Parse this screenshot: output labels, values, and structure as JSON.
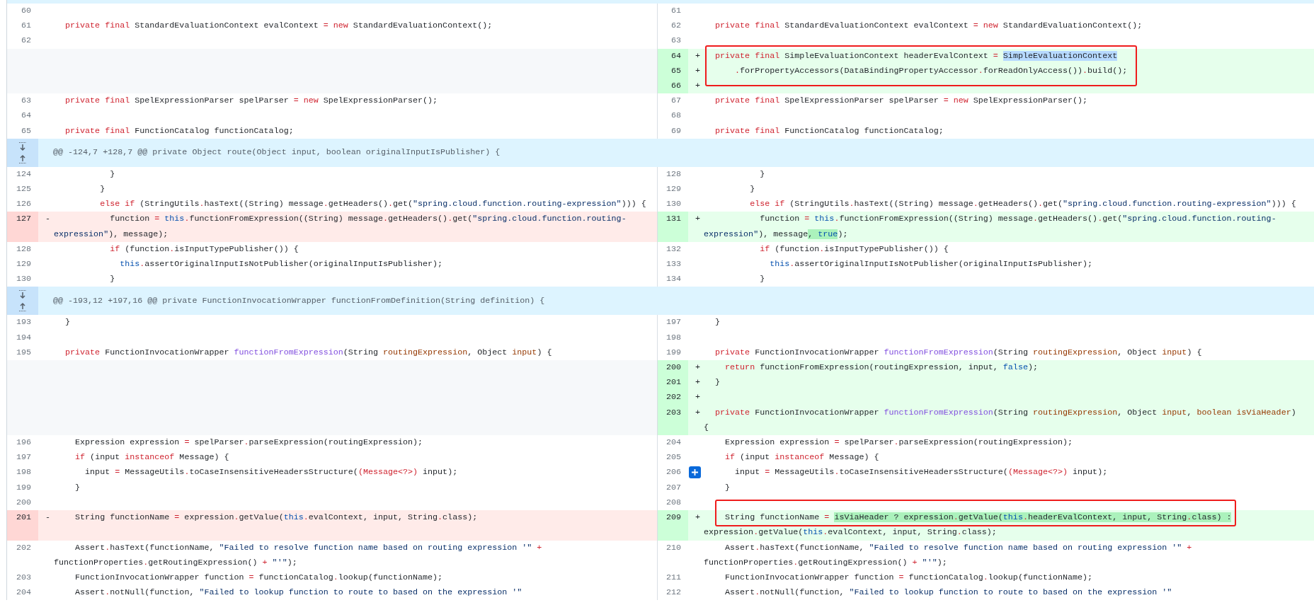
{
  "rows": [
    {
      "kind": "hunk-edge"
    },
    {
      "kind": "line",
      "left": {
        "number": "60",
        "kind": "context"
      },
      "right": {
        "number": "61",
        "kind": "context"
      }
    },
    {
      "kind": "line",
      "left": {
        "number": "61",
        "kind": "context",
        "code": [
          {
            "kind": "keyword",
            "text": "   private"
          },
          {
            "kind": "keyword",
            "text": " final"
          },
          {
            "kind": "plain",
            "text": " StandardEvaluationContext evalContext "
          },
          {
            "kind": "operator",
            "text": "="
          },
          {
            "kind": "keyword",
            "text": " new"
          },
          {
            "kind": "plain",
            "text": " StandardEvaluationContext();"
          }
        ]
      },
      "right": {
        "number": "62",
        "kind": "context",
        "code": [
          {
            "kind": "keyword",
            "text": "   private"
          },
          {
            "kind": "keyword",
            "text": " final"
          },
          {
            "kind": "plain",
            "text": " StandardEvaluationContext evalContext "
          },
          {
            "kind": "operator",
            "text": "="
          },
          {
            "kind": "keyword",
            "text": " new"
          },
          {
            "kind": "plain",
            "text": " StandardEvaluationContext();"
          }
        ]
      }
    },
    {
      "kind": "line",
      "left": {
        "number": "62",
        "kind": "context"
      },
      "right": {
        "number": "63",
        "kind": "context"
      }
    },
    {
      "kind": "line",
      "left": {
        "kind": "empty"
      },
      "right": {
        "number": "64",
        "kind": "added",
        "marker": "+",
        "framed": true,
        "code": [
          {
            "kind": "keyword",
            "text": "   private"
          },
          {
            "kind": "keyword",
            "text": " final"
          },
          {
            "kind": "plain",
            "text": " SimpleEvaluationContext headerEvalContext "
          },
          {
            "kind": "operator",
            "text": "= "
          },
          {
            "kind": "plain",
            "text": "SimpleEvaluationContext",
            "selected": true
          }
        ]
      }
    },
    {
      "kind": "line",
      "left": {
        "kind": "empty"
      },
      "right": {
        "number": "65",
        "kind": "added",
        "marker": "+",
        "framed": true,
        "code": [
          {
            "kind": "operator",
            "text": "       ."
          },
          {
            "kind": "plain",
            "text": "forPropertyAccessors(DataBindingPropertyAccessor"
          },
          {
            "kind": "operator",
            "text": "."
          },
          {
            "kind": "plain",
            "text": "forReadOnlyAccess())"
          },
          {
            "kind": "operator",
            "text": "."
          },
          {
            "kind": "plain",
            "text": "build();"
          }
        ]
      }
    },
    {
      "kind": "line",
      "left": {
        "kind": "empty"
      },
      "right": {
        "number": "66",
        "kind": "added",
        "marker": "+",
        "framed": true
      }
    },
    {
      "kind": "line",
      "left": {
        "number": "63",
        "kind": "context",
        "code": [
          {
            "kind": "keyword",
            "text": "   private"
          },
          {
            "kind": "keyword",
            "text": " final"
          },
          {
            "kind": "plain",
            "text": " SpelExpressionParser spelParser "
          },
          {
            "kind": "operator",
            "text": "="
          },
          {
            "kind": "keyword",
            "text": " new"
          },
          {
            "kind": "plain",
            "text": " SpelExpressionParser();"
          }
        ]
      },
      "right": {
        "number": "67",
        "kind": "context",
        "code": [
          {
            "kind": "keyword",
            "text": "   private"
          },
          {
            "kind": "keyword",
            "text": " final"
          },
          {
            "kind": "plain",
            "text": " SpelExpressionParser spelParser "
          },
          {
            "kind": "operator",
            "text": "="
          },
          {
            "kind": "keyword",
            "text": " new"
          },
          {
            "kind": "plain",
            "text": " SpelExpressionParser();"
          }
        ]
      }
    },
    {
      "kind": "line",
      "left": {
        "number": "64",
        "kind": "context"
      },
      "right": {
        "number": "68",
        "kind": "context"
      }
    },
    {
      "kind": "line",
      "left": {
        "number": "65",
        "kind": "context",
        "code": [
          {
            "kind": "keyword",
            "text": "   private"
          },
          {
            "kind": "keyword",
            "text": " final"
          },
          {
            "kind": "plain",
            "text": " FunctionCatalog functionCatalog;"
          }
        ]
      },
      "right": {
        "number": "69",
        "kind": "context",
        "code": [
          {
            "kind": "keyword",
            "text": "   private"
          },
          {
            "kind": "keyword",
            "text": " final"
          },
          {
            "kind": "plain",
            "text": " FunctionCatalog functionCatalog;"
          }
        ]
      }
    },
    {
      "kind": "hunk",
      "text": "@@ -124,7 +128,7 @@ private Object route(Object input, boolean originalInputIsPublisher) {"
    },
    {
      "kind": "line",
      "left": {
        "number": "124",
        "kind": "context",
        "code": [
          {
            "kind": "plain",
            "text": "            }"
          }
        ]
      },
      "right": {
        "number": "128",
        "kind": "context",
        "code": [
          {
            "kind": "plain",
            "text": "            }"
          }
        ]
      }
    },
    {
      "kind": "line",
      "left": {
        "number": "125",
        "kind": "context",
        "code": [
          {
            "kind": "plain",
            "text": "          }"
          }
        ]
      },
      "right": {
        "number": "129",
        "kind": "context",
        "code": [
          {
            "kind": "plain",
            "text": "          }"
          }
        ]
      }
    },
    {
      "kind": "line",
      "left": {
        "number": "126",
        "kind": "context",
        "code": [
          {
            "kind": "keyword",
            "text": "          else"
          },
          {
            "kind": "keyword",
            "text": " if"
          },
          {
            "kind": "plain",
            "text": " (StringUtils"
          },
          {
            "kind": "operator",
            "text": "."
          },
          {
            "kind": "plain",
            "text": "hasText((String) message"
          },
          {
            "kind": "operator",
            "text": "."
          },
          {
            "kind": "plain",
            "text": "getHeaders()"
          },
          {
            "kind": "operator",
            "text": "."
          },
          {
            "kind": "plain",
            "text": "get("
          },
          {
            "kind": "string",
            "text": "\"spring.cloud.function.routing-expression\""
          },
          {
            "kind": "plain",
            "text": "))) {"
          }
        ]
      },
      "right": {
        "number": "130",
        "kind": "context",
        "code": [
          {
            "kind": "keyword",
            "text": "          else"
          },
          {
            "kind": "keyword",
            "text": " if"
          },
          {
            "kind": "plain",
            "text": " (StringUtils"
          },
          {
            "kind": "operator",
            "text": "."
          },
          {
            "kind": "plain",
            "text": "hasText((String) message"
          },
          {
            "kind": "operator",
            "text": "."
          },
          {
            "kind": "plain",
            "text": "getHeaders()"
          },
          {
            "kind": "operator",
            "text": "."
          },
          {
            "kind": "plain",
            "text": "get("
          },
          {
            "kind": "string",
            "text": "\"spring.cloud.function.routing-expression\""
          },
          {
            "kind": "plain",
            "text": "))) {"
          }
        ]
      }
    },
    {
      "kind": "line",
      "left": {
        "number": "127",
        "kind": "deleted",
        "marker": "-",
        "code": [
          {
            "kind": "plain",
            "text": "            function "
          },
          {
            "kind": "operator",
            "text": "="
          },
          {
            "kind": "constant",
            "text": " this"
          },
          {
            "kind": "operator",
            "text": "."
          },
          {
            "kind": "plain",
            "text": "functionFromExpression((String) message"
          },
          {
            "kind": "operator",
            "text": "."
          },
          {
            "kind": "plain",
            "text": "getHeaders()"
          },
          {
            "kind": "operator",
            "text": "."
          },
          {
            "kind": "plain",
            "text": "get("
          },
          {
            "kind": "string",
            "text": "\"spring.cloud.function.routing-expression\""
          },
          {
            "kind": "plain",
            "text": "), message);"
          }
        ]
      },
      "right": {
        "number": "131",
        "kind": "added",
        "marker": "+",
        "code": [
          {
            "kind": "plain",
            "text": "            function "
          },
          {
            "kind": "operator",
            "text": "="
          },
          {
            "kind": "constant",
            "text": " this"
          },
          {
            "kind": "operator",
            "text": "."
          },
          {
            "kind": "plain",
            "text": "functionFromExpression((String) message"
          },
          {
            "kind": "operator",
            "text": "."
          },
          {
            "kind": "plain",
            "text": "getHeaders()"
          },
          {
            "kind": "operator",
            "text": "."
          },
          {
            "kind": "plain",
            "text": "get("
          },
          {
            "kind": "string",
            "text": "\"spring.cloud.function.routing-expression\""
          },
          {
            "kind": "plain",
            "text": "), message"
          },
          {
            "kind": "plain",
            "text": ", ",
            "changed": true
          },
          {
            "kind": "constant",
            "text": "true",
            "changed": true
          },
          {
            "kind": "plain",
            "text": ");"
          }
        ]
      }
    },
    {
      "kind": "line",
      "left": {
        "number": "128",
        "kind": "context",
        "code": [
          {
            "kind": "keyword",
            "text": "            if"
          },
          {
            "kind": "plain",
            "text": " (function"
          },
          {
            "kind": "operator",
            "text": "."
          },
          {
            "kind": "plain",
            "text": "isInputTypePublisher()) {"
          }
        ]
      },
      "right": {
        "number": "132",
        "kind": "context",
        "code": [
          {
            "kind": "keyword",
            "text": "            if"
          },
          {
            "kind": "plain",
            "text": " (function"
          },
          {
            "kind": "operator",
            "text": "."
          },
          {
            "kind": "plain",
            "text": "isInputTypePublisher()) {"
          }
        ]
      }
    },
    {
      "kind": "line",
      "left": {
        "number": "129",
        "kind": "context",
        "code": [
          {
            "kind": "constant",
            "text": "              this"
          },
          {
            "kind": "operator",
            "text": "."
          },
          {
            "kind": "plain",
            "text": "assertOriginalInputIsNotPublisher(originalInputIsPublisher);"
          }
        ]
      },
      "right": {
        "number": "133",
        "kind": "context",
        "code": [
          {
            "kind": "constant",
            "text": "              this"
          },
          {
            "kind": "operator",
            "text": "."
          },
          {
            "kind": "plain",
            "text": "assertOriginalInputIsNotPublisher(originalInputIsPublisher);"
          }
        ]
      }
    },
    {
      "kind": "line",
      "left": {
        "number": "130",
        "kind": "context",
        "code": [
          {
            "kind": "plain",
            "text": "            }"
          }
        ]
      },
      "right": {
        "number": "134",
        "kind": "context",
        "code": [
          {
            "kind": "plain",
            "text": "            }"
          }
        ]
      }
    },
    {
      "kind": "hunk",
      "text": "@@ -193,12 +197,16 @@ private FunctionInvocationWrapper functionFromDefinition(String definition) {"
    },
    {
      "kind": "line",
      "left": {
        "number": "193",
        "kind": "context",
        "code": [
          {
            "kind": "plain",
            "text": "   }"
          }
        ]
      },
      "right": {
        "number": "197",
        "kind": "context",
        "code": [
          {
            "kind": "plain",
            "text": "   }"
          }
        ]
      }
    },
    {
      "kind": "line",
      "left": {
        "number": "194",
        "kind": "context"
      },
      "right": {
        "number": "198",
        "kind": "context"
      }
    },
    {
      "kind": "line",
      "left": {
        "number": "195",
        "kind": "context",
        "code": [
          {
            "kind": "keyword",
            "text": "   private"
          },
          {
            "kind": "plain",
            "text": " FunctionInvocationWrapper "
          },
          {
            "kind": "function",
            "text": "functionFromExpression"
          },
          {
            "kind": "plain",
            "text": "(String "
          },
          {
            "kind": "parameter",
            "text": "routingExpression"
          },
          {
            "kind": "plain",
            "text": ", Object "
          },
          {
            "kind": "parameter",
            "text": "input"
          },
          {
            "kind": "plain",
            "text": ") {"
          }
        ]
      },
      "right": {
        "number": "199",
        "kind": "context",
        "code": [
          {
            "kind": "keyword",
            "text": "   private"
          },
          {
            "kind": "plain",
            "text": " FunctionInvocationWrapper "
          },
          {
            "kind": "function",
            "text": "functionFromExpression"
          },
          {
            "kind": "plain",
            "text": "(String "
          },
          {
            "kind": "parameter",
            "text": "routingExpression"
          },
          {
            "kind": "plain",
            "text": ", Object "
          },
          {
            "kind": "parameter",
            "text": "input"
          },
          {
            "kind": "plain",
            "text": ") {"
          }
        ]
      }
    },
    {
      "kind": "line",
      "left": {
        "kind": "empty"
      },
      "right": {
        "number": "200",
        "kind": "added",
        "marker": "+",
        "code": [
          {
            "kind": "keyword",
            "text": "     return"
          },
          {
            "kind": "plain",
            "text": " functionFromExpression(routingExpression, input, "
          },
          {
            "kind": "constant",
            "text": "false"
          },
          {
            "kind": "plain",
            "text": ");"
          }
        ]
      }
    },
    {
      "kind": "line",
      "left": {
        "kind": "empty"
      },
      "right": {
        "number": "201",
        "kind": "added",
        "marker": "+",
        "code": [
          {
            "kind": "plain",
            "text": "   }"
          }
        ]
      }
    },
    {
      "kind": "line",
      "left": {
        "kind": "empty"
      },
      "right": {
        "number": "202",
        "kind": "added",
        "marker": "+"
      }
    },
    {
      "kind": "line",
      "left": {
        "kind": "empty"
      },
      "right": {
        "number": "203",
        "kind": "added",
        "marker": "+",
        "code": [
          {
            "kind": "keyword",
            "text": "   private"
          },
          {
            "kind": "plain",
            "text": " FunctionInvocationWrapper "
          },
          {
            "kind": "function",
            "text": "functionFromExpression"
          },
          {
            "kind": "plain",
            "text": "(String "
          },
          {
            "kind": "parameter",
            "text": "routingExpression"
          },
          {
            "kind": "plain",
            "text": ", Object "
          },
          {
            "kind": "parameter",
            "text": "input"
          },
          {
            "kind": "plain",
            "text": ", "
          },
          {
            "kind": "parameter",
            "text": "boolean isViaHeader"
          },
          {
            "kind": "plain",
            "text": ") {"
          }
        ]
      }
    },
    {
      "kind": "line",
      "left": {
        "number": "196",
        "kind": "context",
        "code": [
          {
            "kind": "plain",
            "text": "     Expression expression "
          },
          {
            "kind": "operator",
            "text": "="
          },
          {
            "kind": "plain",
            "text": " spelParser"
          },
          {
            "kind": "operator",
            "text": "."
          },
          {
            "kind": "plain",
            "text": "parseExpression(routingExpression);"
          }
        ]
      },
      "right": {
        "number": "204",
        "kind": "context",
        "code": [
          {
            "kind": "plain",
            "text": "     Expression expression "
          },
          {
            "kind": "operator",
            "text": "="
          },
          {
            "kind": "plain",
            "text": " spelParser"
          },
          {
            "kind": "operator",
            "text": "."
          },
          {
            "kind": "plain",
            "text": "parseExpression(routingExpression);"
          }
        ]
      }
    },
    {
      "kind": "line",
      "left": {
        "number": "197",
        "kind": "context",
        "code": [
          {
            "kind": "keyword",
            "text": "     if"
          },
          {
            "kind": "plain",
            "text": " (input "
          },
          {
            "kind": "keyword",
            "text": "instanceof"
          },
          {
            "kind": "plain",
            "text": " Message) {"
          }
        ]
      },
      "right": {
        "number": "205",
        "kind": "context",
        "code": [
          {
            "kind": "keyword",
            "text": "     if"
          },
          {
            "kind": "plain",
            "text": " (input "
          },
          {
            "kind": "keyword",
            "text": "instanceof"
          },
          {
            "kind": "plain",
            "text": " Message) {"
          }
        ]
      }
    },
    {
      "kind": "line",
      "left": {
        "number": "198",
        "kind": "context",
        "code": [
          {
            "kind": "plain",
            "text": "       input "
          },
          {
            "kind": "operator",
            "text": "="
          },
          {
            "kind": "plain",
            "text": " MessageUtils"
          },
          {
            "kind": "operator",
            "text": "."
          },
          {
            "kind": "plain",
            "text": "toCaseInsensitiveHeadersStructure("
          },
          {
            "kind": "keyword",
            "text": "(Message<?>)"
          },
          {
            "kind": "plain",
            "text": " input);"
          }
        ]
      },
      "right": {
        "number": "206",
        "kind": "context",
        "comment_button": true,
        "code": [
          {
            "kind": "plain",
            "text": "       input "
          },
          {
            "kind": "operator",
            "text": "="
          },
          {
            "kind": "plain",
            "text": " MessageUtils"
          },
          {
            "kind": "operator",
            "text": "."
          },
          {
            "kind": "plain",
            "text": "toCaseInsensitiveHeadersStructure("
          },
          {
            "kind": "keyword",
            "text": "(Message<?>)"
          },
          {
            "kind": "plain",
            "text": " input);"
          }
        ]
      }
    },
    {
      "kind": "line",
      "left": {
        "number": "199",
        "kind": "context",
        "code": [
          {
            "kind": "plain",
            "text": "     }"
          }
        ]
      },
      "right": {
        "number": "207",
        "kind": "context",
        "code": [
          {
            "kind": "plain",
            "text": "     }"
          }
        ]
      }
    },
    {
      "kind": "line",
      "left": {
        "number": "200",
        "kind": "context"
      },
      "right": {
        "number": "208",
        "kind": "context",
        "framed": true
      }
    },
    {
      "kind": "line",
      "left": {
        "number": "201",
        "kind": "deleted",
        "marker": "-",
        "code": [
          {
            "kind": "plain",
            "text": "     String functionName "
          },
          {
            "kind": "operator",
            "text": "="
          },
          {
            "kind": "plain",
            "text": " expression"
          },
          {
            "kind": "operator",
            "text": "."
          },
          {
            "kind": "plain",
            "text": "getValue("
          },
          {
            "kind": "constant",
            "text": "this"
          },
          {
            "kind": "operator",
            "text": "."
          },
          {
            "kind": "plain",
            "text": "evalContext, input, String"
          },
          {
            "kind": "operator",
            "text": "."
          },
          {
            "kind": "plain",
            "text": "class);"
          }
        ]
      },
      "right": {
        "number": "209",
        "kind": "added",
        "marker": "+",
        "framed": true,
        "code": [
          {
            "kind": "plain",
            "text": "     String functionName "
          },
          {
            "kind": "operator",
            "text": "= "
          },
          {
            "kind": "plain",
            "text": "isViaHeader ? expression",
            "changed": true
          },
          {
            "kind": "operator",
            "text": ".",
            "changed": true
          },
          {
            "kind": "plain",
            "text": "getValue(",
            "changed": true
          },
          {
            "kind": "constant",
            "text": "this",
            "changed": true
          },
          {
            "kind": "operator",
            "text": ".",
            "changed": true
          },
          {
            "kind": "plain",
            "text": "headerEvalContext, input, String",
            "changed": true
          },
          {
            "kind": "operator",
            "text": ".",
            "changed": true
          },
          {
            "kind": "plain",
            "text": "class) :",
            "changed": true
          },
          {
            "kind": "plain",
            "text": " expression"
          },
          {
            "kind": "operator",
            "text": "."
          },
          {
            "kind": "plain",
            "text": "getValue("
          },
          {
            "kind": "constant",
            "text": "this"
          },
          {
            "kind": "operator",
            "text": "."
          },
          {
            "kind": "plain",
            "text": "evalContext, input, String"
          },
          {
            "kind": "operator",
            "text": "."
          },
          {
            "kind": "plain",
            "text": "class);"
          }
        ]
      }
    },
    {
      "kind": "line",
      "left": {
        "number": "202",
        "kind": "context",
        "code": [
          {
            "kind": "plain",
            "text": "     Assert"
          },
          {
            "kind": "operator",
            "text": "."
          },
          {
            "kind": "plain",
            "text": "hasText(functionName, "
          },
          {
            "kind": "string",
            "text": "\"Failed to resolve function name based on routing expression '\""
          },
          {
            "kind": "operator",
            "text": " +"
          },
          {
            "kind": "plain",
            "text": " functionProperties"
          },
          {
            "kind": "operator",
            "text": "."
          },
          {
            "kind": "plain",
            "text": "getRoutingExpression() "
          },
          {
            "kind": "operator",
            "text": "+"
          },
          {
            "kind": "string",
            "text": " \"'\""
          },
          {
            "kind": "plain",
            "text": ");"
          }
        ]
      },
      "right": {
        "number": "210",
        "kind": "context",
        "code": [
          {
            "kind": "plain",
            "text": "     Assert"
          },
          {
            "kind": "operator",
            "text": "."
          },
          {
            "kind": "plain",
            "text": "hasText(functionName, "
          },
          {
            "kind": "string",
            "text": "\"Failed to resolve function name based on routing expression '\""
          },
          {
            "kind": "operator",
            "text": " +"
          },
          {
            "kind": "plain",
            "text": " functionProperties"
          },
          {
            "kind": "operator",
            "text": "."
          },
          {
            "kind": "plain",
            "text": "getRoutingExpression() "
          },
          {
            "kind": "operator",
            "text": "+"
          },
          {
            "kind": "string",
            "text": " \"'\""
          },
          {
            "kind": "plain",
            "text": ");"
          }
        ]
      }
    },
    {
      "kind": "line",
      "left": {
        "number": "203",
        "kind": "context",
        "code": [
          {
            "kind": "plain",
            "text": "     FunctionInvocationWrapper function "
          },
          {
            "kind": "operator",
            "text": "="
          },
          {
            "kind": "plain",
            "text": " functionCatalog"
          },
          {
            "kind": "operator",
            "text": "."
          },
          {
            "kind": "plain",
            "text": "lookup(functionName);"
          }
        ]
      },
      "right": {
        "number": "211",
        "kind": "context",
        "code": [
          {
            "kind": "plain",
            "text": "     FunctionInvocationWrapper function "
          },
          {
            "kind": "operator",
            "text": "="
          },
          {
            "kind": "plain",
            "text": " functionCatalog"
          },
          {
            "kind": "operator",
            "text": "."
          },
          {
            "kind": "plain",
            "text": "lookup(functionName);"
          }
        ]
      }
    },
    {
      "kind": "line",
      "left": {
        "number": "204",
        "kind": "context",
        "code": [
          {
            "kind": "plain",
            "text": "     Assert"
          },
          {
            "kind": "operator",
            "text": "."
          },
          {
            "kind": "plain",
            "text": "notNull(function, "
          },
          {
            "kind": "string",
            "text": "\"Failed to lookup function to route to based on the expression '\""
          }
        ]
      },
      "right": {
        "number": "212",
        "kind": "context",
        "code": [
          {
            "kind": "plain",
            "text": "     Assert"
          },
          {
            "kind": "operator",
            "text": "."
          },
          {
            "kind": "plain",
            "text": "notNull(function, "
          },
          {
            "kind": "string",
            "text": "\"Failed to lookup function to route to based on the expression '\""
          }
        ]
      }
    }
  ]
}
